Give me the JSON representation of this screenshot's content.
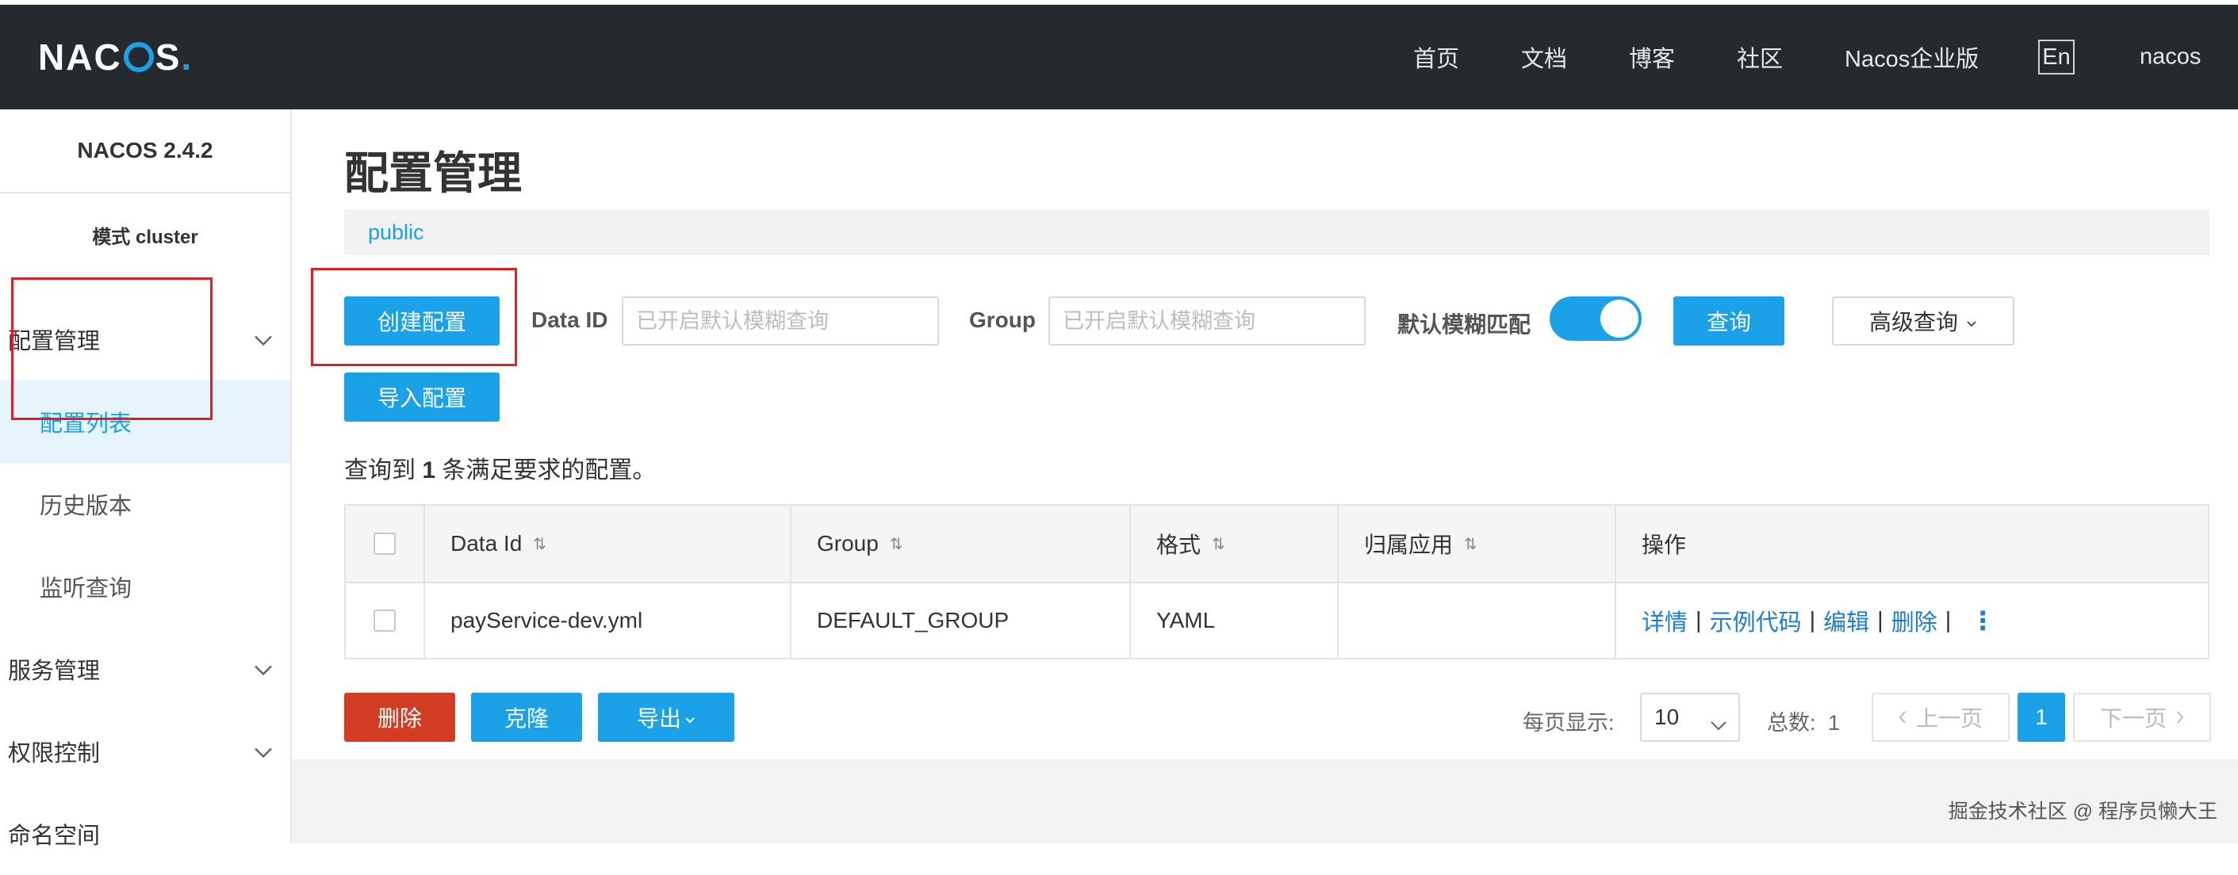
{
  "header": {
    "logo_text": "NACOS.",
    "nav": [
      "首页",
      "文档",
      "博客",
      "社区",
      "Nacos企业版"
    ],
    "lang_button": "En",
    "user": "nacos"
  },
  "sidebar": {
    "version": "NACOS 2.4.2",
    "mode": "模式 cluster",
    "groups": [
      {
        "label": "配置管理",
        "children": [
          "配置列表",
          "历史版本",
          "监听查询"
        ]
      },
      {
        "label": "服务管理"
      },
      {
        "label": "权限控制"
      },
      {
        "label": "命名空间"
      }
    ],
    "active_item": "配置列表"
  },
  "main": {
    "title": "配置管理",
    "namespace": "public",
    "create_button": "创建配置",
    "import_button": "导入配置",
    "data_id_label": "Data ID",
    "data_id_placeholder": "已开启默认模糊查询",
    "group_label": "Group",
    "group_placeholder": "已开启默认模糊查询",
    "fuzzy_label": "默认模糊匹配",
    "fuzzy_enabled": true,
    "query_button": "查询",
    "advanced_button": "高级查询",
    "result_prefix": "查询到",
    "result_count": "1",
    "result_suffix": "条满足要求的配置。"
  },
  "table": {
    "columns": [
      "Data Id",
      "Group",
      "格式",
      "归属应用",
      "操作"
    ],
    "rows": [
      {
        "data_id": "payService-dev.yml",
        "group": "DEFAULT_GROUP",
        "format": "YAML",
        "app": ""
      }
    ],
    "actions": [
      "详情",
      "示例代码",
      "编辑",
      "删除"
    ]
  },
  "bulk_actions": {
    "delete": "删除",
    "clone": "克隆",
    "export": "导出"
  },
  "pagination": {
    "page_size_label": "每页显示:",
    "page_size": "10",
    "total_label": "总数:",
    "total": "1",
    "prev": "上一页",
    "current_page": "1",
    "next": "下一页"
  },
  "watermark": "掘金技术社区 @ 程序员懒大王",
  "colors": {
    "header_bg": "#252a2f",
    "primary": "#1aa1e8",
    "danger": "#d23c22",
    "link": "#1a7dd6",
    "annotation_red": "#e02020"
  }
}
